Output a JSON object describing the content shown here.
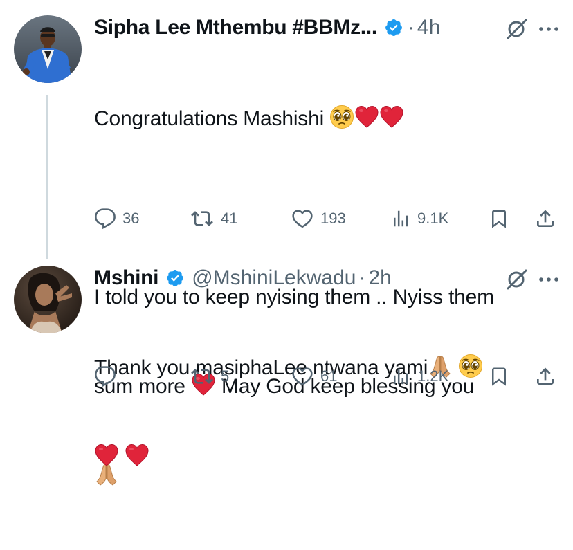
{
  "tweets": [
    {
      "display_name": "Sipha Lee Mthembu #BBMz...",
      "handle": "",
      "separator": "·",
      "time": "4h",
      "lines": [
        "Congratulations Mashishi",
        "",
        "I told you to keep nyising them .. Nyiss them",
        "sum more",
        "May God keep blessing you"
      ],
      "stats": {
        "replies": "36",
        "reposts": "41",
        "likes": "193",
        "views": "9.1K"
      }
    },
    {
      "display_name": "Mshini",
      "handle": "@MshiniLekwadu",
      "separator": "·",
      "time": "2h",
      "lines": [
        "Thank you masiphaLee ntwana yami"
      ],
      "stats": {
        "replies": "",
        "reposts": "5",
        "likes": "61",
        "views": "1.2K"
      }
    }
  ],
  "icons": {
    "verified": "verified-badge-icon",
    "grok": "grok-icon",
    "more": "more-icon",
    "reply": "reply-icon",
    "repost": "repost-icon",
    "like": "like-icon",
    "views": "views-icon",
    "bookmark": "bookmark-icon",
    "share": "share-icon",
    "emoji": [
      "pleading-face-emoji",
      "red-heart-emoji",
      "folded-hands-emoji"
    ]
  },
  "colors": {
    "verified": "#1d9bf0",
    "text": "#0f1419",
    "muted": "#536471",
    "heart": "#e0243a",
    "thread_line": "#cfd9de"
  }
}
